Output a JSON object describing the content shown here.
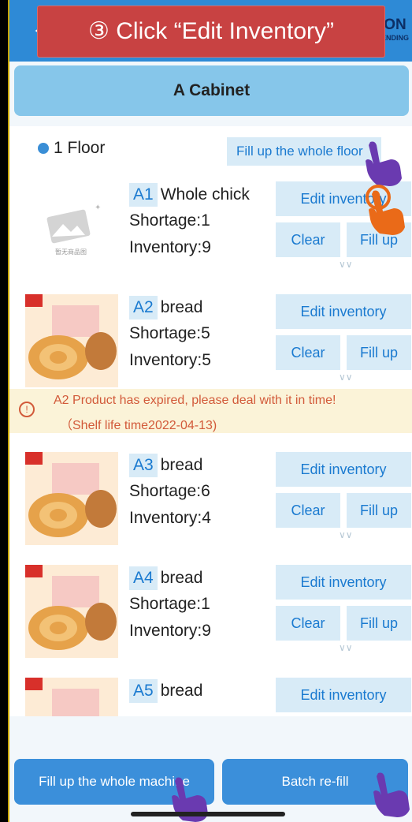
{
  "callout": "③ Click “Edit Inventory”",
  "brand": {
    "main": "ON",
    "sub": "ENDING"
  },
  "cabinet_title": "A Cabinet",
  "floor": {
    "label": "1 Floor",
    "fill_button": "Fill up the whole floor"
  },
  "items": [
    {
      "code": "A1",
      "name": "Whole chick",
      "shortage": "Shortage:1",
      "inventory": "Inventory:9",
      "edit": "Edit inventory",
      "clear": "Clear",
      "fill": "Fill up",
      "thumb_caption": "暂无商品图"
    },
    {
      "code": "A2",
      "name": "bread",
      "shortage": "Shortage:5",
      "inventory": "Inventory:5",
      "edit": "Edit inventory",
      "clear": "Clear",
      "fill": "Fill up"
    },
    {
      "code": "A3",
      "name": "bread",
      "shortage": "Shortage:6",
      "inventory": "Inventory:4",
      "edit": "Edit inventory",
      "clear": "Clear",
      "fill": "Fill up"
    },
    {
      "code": "A4",
      "name": "bread",
      "shortage": "Shortage:1",
      "inventory": "Inventory:9",
      "edit": "Edit inventory",
      "clear": "Clear",
      "fill": "Fill up"
    },
    {
      "code": "A5",
      "name": "bread",
      "edit": "Edit inventory"
    }
  ],
  "alert": {
    "line1": "A2 Product has expired, please deal with it in time!",
    "line2": "（Shelf life time2022-04-13)"
  },
  "bottom": {
    "fill_machine": "Fill up the whole machine",
    "batch": "Batch re-fill"
  },
  "colors": {
    "primary": "#3b8fda",
    "callout": "#c84242",
    "cabinet": "#86c6ea",
    "alert_text": "#d25a3a"
  }
}
